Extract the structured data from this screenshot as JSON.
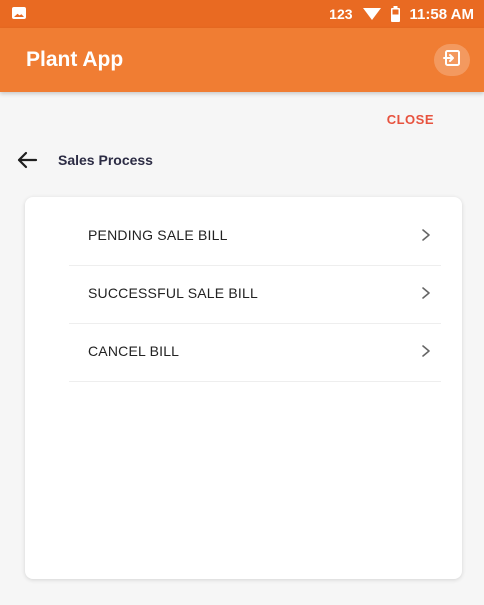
{
  "status_bar": {
    "network_label": "123",
    "time": "11:58 AM",
    "icons": [
      "image-icon",
      "wifi-icon",
      "battery-icon"
    ]
  },
  "app_bar": {
    "title": "Plant App",
    "action_icon": "logout-icon"
  },
  "close_label": "CLOSE",
  "section": {
    "title": "Sales Process",
    "back_icon": "arrow-left-icon"
  },
  "menu": {
    "items": [
      {
        "label": "PENDING SALE BILL",
        "icon": "chevron-right-icon"
      },
      {
        "label": "SUCCESSFUL SALE BILL",
        "icon": "chevron-right-icon"
      },
      {
        "label": "CANCEL BILL",
        "icon": "chevron-right-icon"
      }
    ]
  },
  "colors": {
    "status_bar": "#e96a22",
    "app_bar": "#f07d33",
    "close_text": "#e7523e",
    "section_title": "#2c2c44",
    "background": "#f6f6f6"
  }
}
